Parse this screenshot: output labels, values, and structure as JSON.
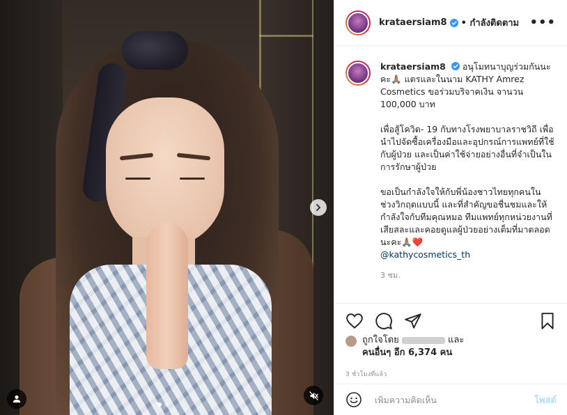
{
  "post": {
    "username": "krataersiam8",
    "follow_status": "• กำลังติดตาม",
    "more_label": "•••",
    "caption_username": "krataersiam8",
    "caption_para1": "อนุโมทนาบุญร่วมกันนะคะ🙏🏽 แตรและในนาม KATHY Amrez Cosmetics ขอร่วมบริจาคเงิน จานวน 100,000 บาท",
    "caption_para2": "เพื่อสู้โควิด- 19 กับทางโรงพยาบาลราชวิถี เพื่อนำไปจัดซื้อเครื่องมือและอุปกรณ์การแพทย์ที่ใช้กับผู้ป่วย และเป็นค่าใช้จ่ายอย่างอื่นที่จำเป็นในการรักษาผู้ป่วย",
    "caption_para3": "ขอเป็นกำลังใจให้กับพี่น้องชาวไทยทุกคนในช่วงวิกฤตแบบนี้ และที่สำคัญขอชื่นชมและให้กำลังใจกับทีมคุณหมอ ทีมแพทย์ทุกหน่วยงานที่เสียสละและคอยดูแลผู้ป่วยอย่างเต็มที่มาตลอดนะคะ🙏🏽❤️",
    "caption_mention": "@kathycosmetics_th",
    "caption_time": "3 ชม.",
    "liked_by_prefix": "ถูกใจโดย",
    "liked_by_and": "และ",
    "liked_by_others": "คนอื่นๆ อีก 6,374 คน",
    "posted_time": "3 ชั่วโมงที่แล้ว",
    "comment_placeholder": "เพิ่มความคิดเห็น",
    "post_button": "โพสต์"
  },
  "media": {
    "carousel_count": 2,
    "carousel_active": 1
  },
  "icons": {
    "verified": "verified-badge-icon",
    "like": "heart-icon",
    "comment": "comment-bubble-icon",
    "share": "paper-plane-icon",
    "save": "bookmark-icon",
    "emoji": "smiley-icon",
    "next": "chevron-right-icon",
    "user_tag": "user-silhouette-icon",
    "mute": "speaker-muted-icon"
  },
  "colors": {
    "verified_blue": "#3897f0",
    "post_button_disabled": "#b2dffc",
    "mention": "#00376b",
    "muted_text": "#8e8e8e"
  }
}
